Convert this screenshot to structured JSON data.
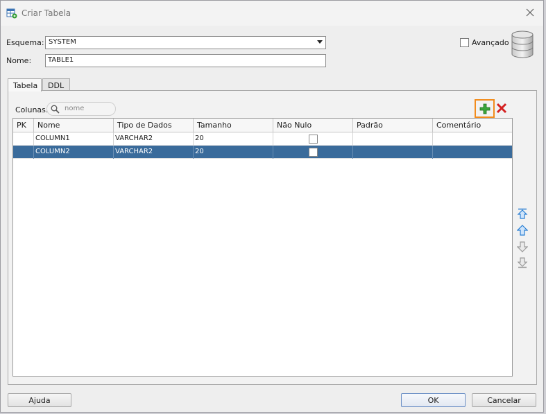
{
  "window": {
    "title": "Criar Tabela"
  },
  "form": {
    "schema_label": "Esquema:",
    "schema_value": "SYSTEM",
    "name_label": "Nome:",
    "name_value": "TABLE1",
    "advanced_label": "Avançado",
    "advanced_checked": false
  },
  "tabs": [
    {
      "label": "Tabela",
      "active": true
    },
    {
      "label": "DDL",
      "active": false
    }
  ],
  "columns_bar": {
    "label": "Colunas:",
    "search_placeholder": "nome"
  },
  "grid": {
    "headers": [
      "PK",
      "Nome",
      "Tipo de Dados",
      "Tamanho",
      "Não Nulo",
      "Padrão",
      "Comentário"
    ],
    "rows": [
      {
        "pk": "",
        "name": "COLUMN1",
        "type": "VARCHAR2",
        "size": "20",
        "not_null": false,
        "default": "",
        "comment": "",
        "selected": false
      },
      {
        "pk": "",
        "name": "COLUMN2",
        "type": "VARCHAR2",
        "size": "20",
        "not_null": false,
        "default": "",
        "comment": "",
        "selected": true
      }
    ]
  },
  "icons": {
    "add": "plus-icon",
    "delete": "delete-x-icon",
    "move_top": "move-top-icon",
    "move_up": "move-up-icon",
    "move_down": "move-down-icon",
    "move_bottom": "move-bottom-icon",
    "database": "database-icon",
    "search": "search-icon",
    "close": "close-icon"
  },
  "colors": {
    "selection": "#3a6b9b",
    "add_highlight": "#f28c1c",
    "add_icon": "#2e9b2e",
    "delete_icon": "#d42020",
    "arrow_active": "#2a7fd4"
  },
  "buttons": {
    "help": "Ajuda",
    "ok": "OK",
    "cancel": "Cancelar"
  }
}
